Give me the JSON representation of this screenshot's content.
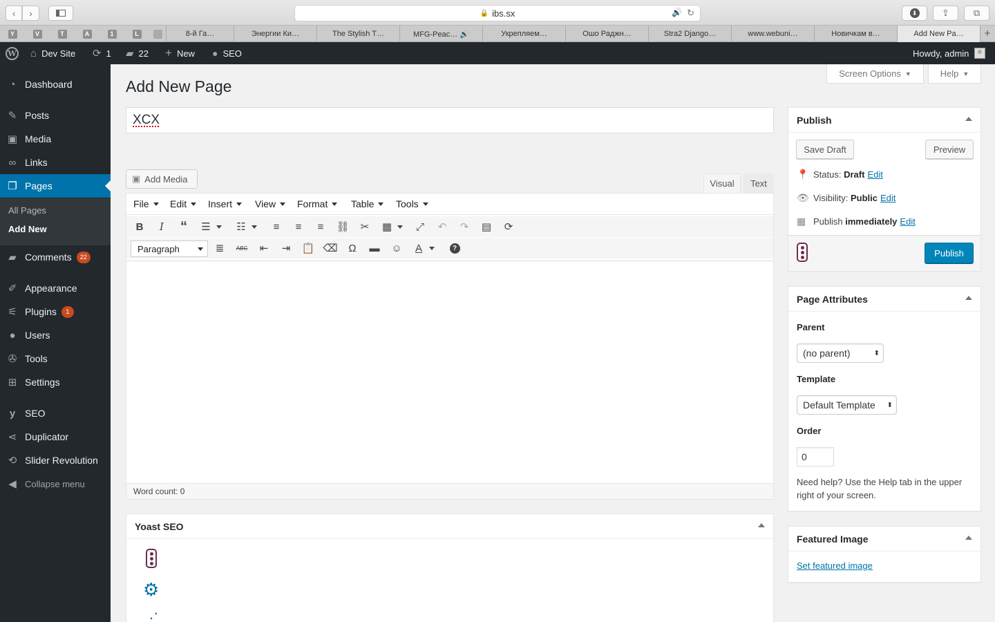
{
  "browser": {
    "url": "ibs.sx",
    "pinned_tabs": [
      "Y",
      "V",
      "T",
      "A",
      "1",
      "L",
      ""
    ],
    "tabs": [
      {
        "label": "8-й Га…",
        "active": false
      },
      {
        "label": "Энергии Ки…",
        "active": false
      },
      {
        "label": "The Stylish T…",
        "active": false
      },
      {
        "label": "MFG-Peac… 🔊",
        "active": false
      },
      {
        "label": "Укрепляем…",
        "active": false
      },
      {
        "label": "Ошо Раджн…",
        "active": false
      },
      {
        "label": "Stra2 Django…",
        "active": false
      },
      {
        "label": "www.webuni…",
        "active": false
      },
      {
        "label": "Новичкам в…",
        "active": false
      },
      {
        "label": "Add New Pa…",
        "active": true
      }
    ]
  },
  "adminbar": {
    "site_name": "Dev Site",
    "updates_count": "1",
    "comments_count": "22",
    "new_label": "New",
    "seo_label": "SEO",
    "greeting": "Howdy, admin"
  },
  "sidebar": {
    "items": [
      {
        "label": "Dashboard",
        "icon": "dashboard-icon"
      },
      {
        "label": "Posts",
        "icon": "pin-icon"
      },
      {
        "label": "Media",
        "icon": "media-icon"
      },
      {
        "label": "Links",
        "icon": "link-icon"
      },
      {
        "label": "Pages",
        "icon": "pages-icon"
      },
      {
        "label": "Comments",
        "icon": "comment-icon",
        "badge": "22"
      },
      {
        "label": "Appearance",
        "icon": "brush-icon"
      },
      {
        "label": "Plugins",
        "icon": "plugin-icon",
        "badge": "1"
      },
      {
        "label": "Users",
        "icon": "user-icon"
      },
      {
        "label": "Tools",
        "icon": "wrench-icon"
      },
      {
        "label": "Settings",
        "icon": "settings-icon"
      },
      {
        "label": "SEO",
        "icon": "yoast-icon"
      },
      {
        "label": "Duplicator",
        "icon": "share-icon"
      },
      {
        "label": "Slider Revolution",
        "icon": "refresh-icon"
      }
    ],
    "submenu": [
      "All Pages",
      "Add New"
    ],
    "collapse_label": "Collapse menu"
  },
  "header": {
    "screen_options": "Screen Options",
    "help": "Help",
    "page_title": "Add New Page"
  },
  "editor": {
    "title_value": "XCX",
    "add_media": "Add Media",
    "tab_visual": "Visual",
    "tab_text": "Text",
    "menus": [
      "File",
      "Edit",
      "Insert",
      "View",
      "Format",
      "Table",
      "Tools"
    ],
    "format_select": "Paragraph",
    "word_count": "Word count: 0"
  },
  "publish": {
    "title": "Publish",
    "save_draft": "Save Draft",
    "preview": "Preview",
    "status_label": "Status:",
    "status_value": "Draft",
    "visibility_label": "Visibility:",
    "visibility_value": "Public",
    "publish_label": "Publish",
    "publish_value": "immediately",
    "edit": "Edit",
    "publish_button": "Publish"
  },
  "attributes": {
    "title": "Page Attributes",
    "parent_label": "Parent",
    "parent_value": "(no parent)",
    "template_label": "Template",
    "template_value": "Default Template",
    "order_label": "Order",
    "order_value": "0",
    "help": "Need help? Use the Help tab in the upper right of your screen."
  },
  "featured": {
    "title": "Featured Image",
    "link": "Set featured image"
  },
  "yoast": {
    "title": "Yoast SEO"
  },
  "colors": {
    "admin_dark": "#23282d",
    "accent": "#0073aa",
    "badge": "#ca4a1f"
  }
}
